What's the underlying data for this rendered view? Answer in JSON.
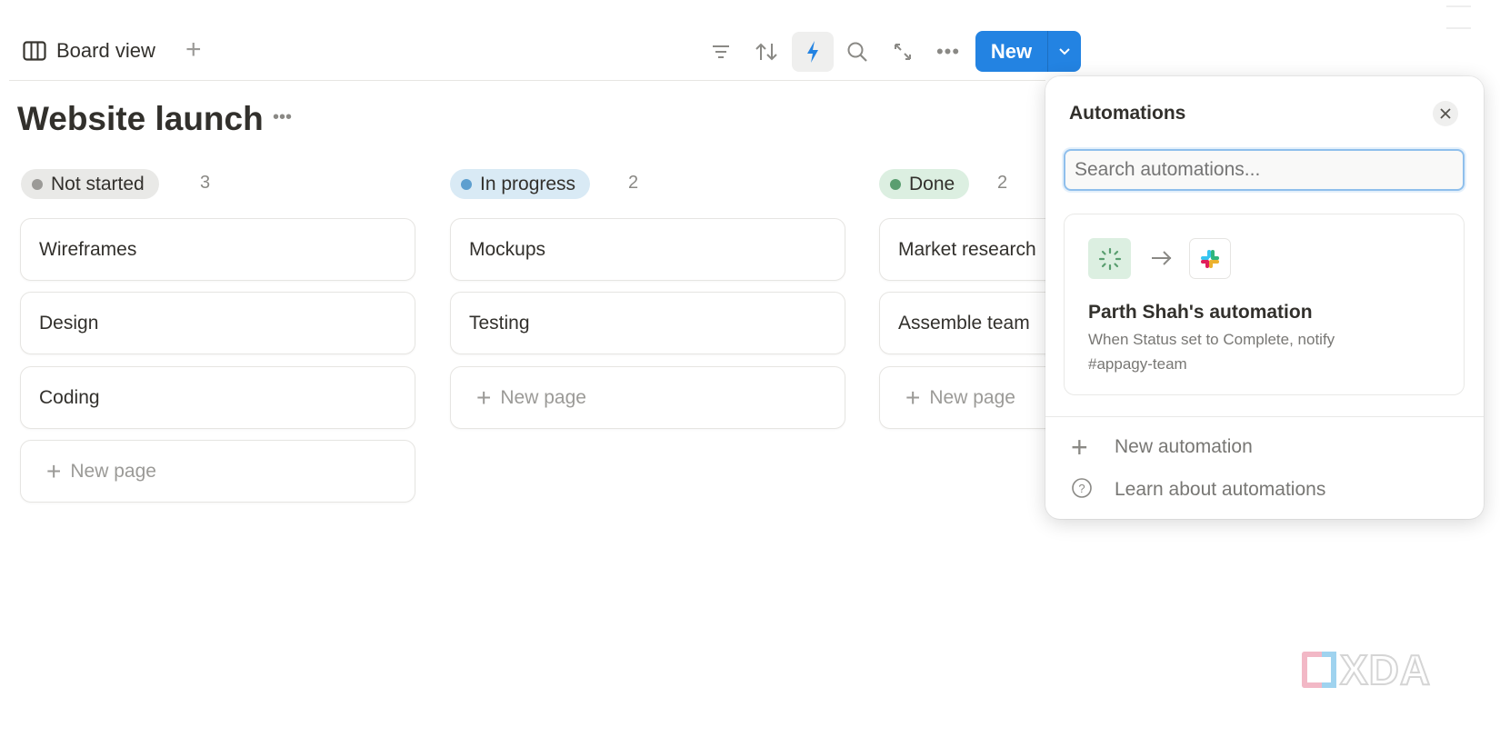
{
  "toolbar": {
    "view_label": "Board view",
    "new_label": "New",
    "icons": [
      "board-icon",
      "add-view",
      "filter",
      "sort",
      "automations-bolt",
      "search",
      "expand",
      "more",
      "chevron-down"
    ]
  },
  "page": {
    "title": "Website launch"
  },
  "columns": [
    {
      "status": "Not started",
      "count": "3",
      "color": "#9b9a97",
      "bg": "#e9e9e7",
      "cards": [
        "Wireframes",
        "Design",
        "Coding"
      ]
    },
    {
      "status": "In progress",
      "count": "2",
      "color": "#5e9fcf",
      "bg": "#d9eaf5",
      "cards": [
        "Mockups",
        "Testing"
      ]
    },
    {
      "status": "Done",
      "count": "2",
      "color": "#5a9e70",
      "bg": "#dcefe1",
      "cards": [
        "Market research",
        "Assemble team"
      ]
    }
  ],
  "new_page_label": "New page",
  "automations": {
    "title": "Automations",
    "search_placeholder": "Search automations...",
    "item": {
      "name": "Parth Shah's automation",
      "desc_line1": "When Status set to Complete, notify",
      "desc_line2": "#appagy-team"
    },
    "new_automation": "New automation",
    "learn": "Learn about automations"
  },
  "watermark": "XDA",
  "colors": {
    "accent": "#2383e2",
    "text": "#37352f",
    "muted": "#9b9a97"
  }
}
